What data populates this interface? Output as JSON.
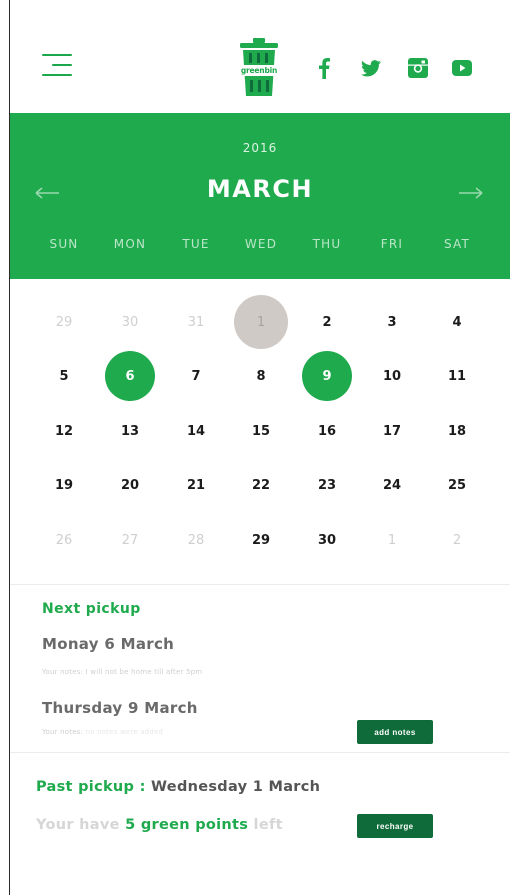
{
  "header": {
    "logo_text": "greenbin",
    "social": [
      "facebook-icon",
      "twitter-icon",
      "instagram-icon",
      "youtube-icon"
    ]
  },
  "calendar": {
    "year": "2016",
    "month": "MARCH",
    "weekdays": [
      "SUN",
      "MON",
      "TUE",
      "WED",
      "THU",
      "FRI",
      "SAT"
    ],
    "weeks": [
      [
        {
          "d": "29",
          "state": "muted"
        },
        {
          "d": "30",
          "state": "muted"
        },
        {
          "d": "31",
          "state": "muted"
        },
        {
          "d": "1",
          "state": "past"
        },
        {
          "d": "2",
          "state": "normal"
        },
        {
          "d": "3",
          "state": "normal"
        },
        {
          "d": "4",
          "state": "normal"
        }
      ],
      [
        {
          "d": "5",
          "state": "normal"
        },
        {
          "d": "6",
          "state": "pickup"
        },
        {
          "d": "7",
          "state": "normal"
        },
        {
          "d": "8",
          "state": "normal"
        },
        {
          "d": "9",
          "state": "pickup"
        },
        {
          "d": "10",
          "state": "normal"
        },
        {
          "d": "11",
          "state": "normal"
        }
      ],
      [
        {
          "d": "12",
          "state": "normal"
        },
        {
          "d": "13",
          "state": "normal"
        },
        {
          "d": "14",
          "state": "normal"
        },
        {
          "d": "15",
          "state": "normal"
        },
        {
          "d": "16",
          "state": "normal"
        },
        {
          "d": "17",
          "state": "normal"
        },
        {
          "d": "18",
          "state": "normal"
        }
      ],
      [
        {
          "d": "19",
          "state": "normal"
        },
        {
          "d": "20",
          "state": "normal"
        },
        {
          "d": "21",
          "state": "normal"
        },
        {
          "d": "22",
          "state": "normal"
        },
        {
          "d": "23",
          "state": "normal"
        },
        {
          "d": "24",
          "state": "normal"
        },
        {
          "d": "25",
          "state": "normal"
        }
      ],
      [
        {
          "d": "26",
          "state": "muted"
        },
        {
          "d": "27",
          "state": "muted"
        },
        {
          "d": "28",
          "state": "muted"
        },
        {
          "d": "29",
          "state": "normal"
        },
        {
          "d": "30",
          "state": "normal"
        },
        {
          "d": "1",
          "state": "muted"
        },
        {
          "d": "2",
          "state": "muted"
        }
      ]
    ]
  },
  "next_pickup": {
    "title": "Next pickup",
    "items": [
      {
        "date": "Monay 6 March",
        "note_prefix": "Your notes: ",
        "note_text": "I will not be home till after 5pm"
      },
      {
        "date": "Thursday 9 March",
        "note_prefix": "Your notes: ",
        "note_text": "no notes were added"
      }
    ],
    "add_notes_label": "add notes"
  },
  "past_pickup": {
    "label": "Past pickup",
    "separator": " : ",
    "value": "Wednesday 1 March"
  },
  "points": {
    "prefix": "Your have ",
    "amount": "5 green points",
    "suffix": " left",
    "recharge_label": "recharge"
  },
  "colors": {
    "brand_green": "#1faa4d",
    "dark_green": "#0f6b3a",
    "past_gray": "#cfcac6"
  }
}
